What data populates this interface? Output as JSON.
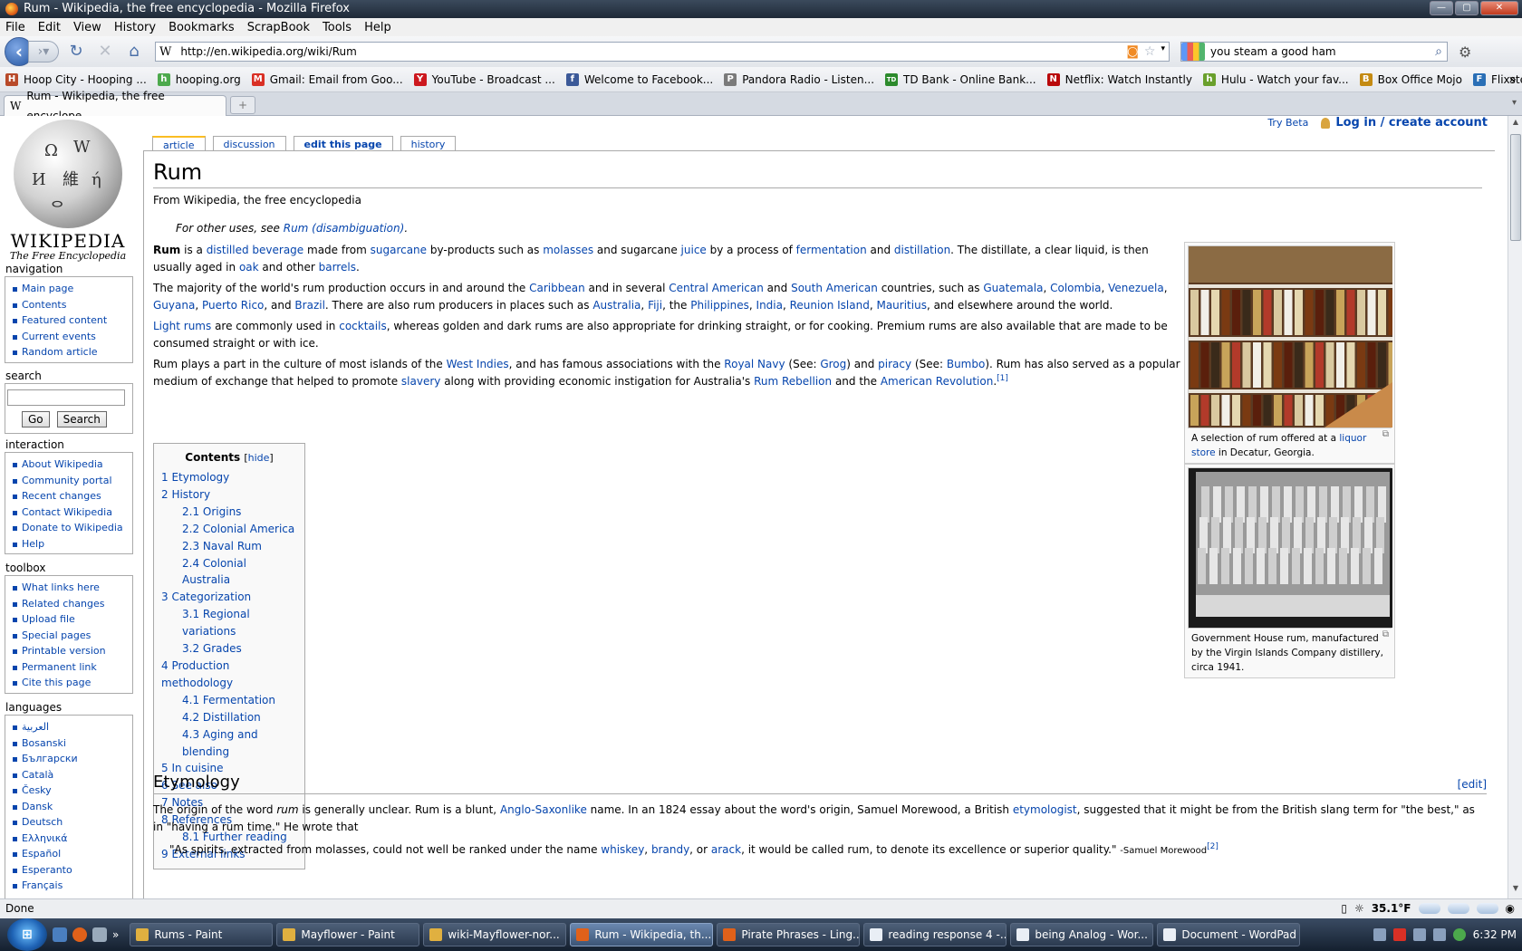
{
  "window": {
    "title": "Rum - Wikipedia, the free encyclopedia - Mozilla Firefox"
  },
  "menu": [
    "File",
    "Edit",
    "View",
    "History",
    "Bookmarks",
    "ScrapBook",
    "Tools",
    "Help"
  ],
  "toolbar": {
    "url": "http://en.wikipedia.org/wiki/Rum",
    "search_value": "you steam a good ham"
  },
  "bookmarks": [
    {
      "label": "Hoop City - Hooping ...",
      "color": "#b84a2a",
      "icon": "H"
    },
    {
      "label": "hooping.org",
      "color": "#4ca94c",
      "icon": "h"
    },
    {
      "label": "Gmail: Email from Goo...",
      "color": "#d93025",
      "icon": "M"
    },
    {
      "label": "YouTube - Broadcast ...",
      "color": "#cc181e",
      "icon": "Y"
    },
    {
      "label": "Welcome to Facebook...",
      "color": "#3b5998",
      "icon": "f"
    },
    {
      "label": "Pandora Radio - Listen...",
      "color": "#7a7a7a",
      "icon": "P"
    },
    {
      "label": "TD Bank - Online Bank...",
      "color": "#2c8a2c",
      "icon": "TD"
    },
    {
      "label": "Netflix: Watch Instantly",
      "color": "#b9090b",
      "icon": "N"
    },
    {
      "label": "Hulu - Watch your fav...",
      "color": "#6aa02c",
      "icon": "h"
    },
    {
      "label": "Box Office Mojo",
      "color": "#c48a12",
      "icon": "B"
    },
    {
      "label": "Flixster - Share Movie ...",
      "color": "#2a6fb6",
      "icon": "F"
    }
  ],
  "tab": {
    "title": "Rum - Wikipedia, the free encyclope...",
    "favicon": "W"
  },
  "personal": {
    "try_beta": "Try Beta",
    "login": "Log in / create account"
  },
  "page_tabs": {
    "article": "article",
    "discussion": "discussion",
    "edit": "edit this page",
    "history": "history"
  },
  "sidebar": {
    "logo_word": "Wikipedia",
    "logo_tagline": "The Free Encyclopedia",
    "navigation_title": "navigation",
    "navigation": [
      "Main page",
      "Contents",
      "Featured content",
      "Current events",
      "Random article"
    ],
    "search_title": "search",
    "go_label": "Go",
    "search_label": "Search",
    "interaction_title": "interaction",
    "interaction": [
      "About Wikipedia",
      "Community portal",
      "Recent changes",
      "Contact Wikipedia",
      "Donate to Wikipedia",
      "Help"
    ],
    "toolbox_title": "toolbox",
    "toolbox": [
      "What links here",
      "Related changes",
      "Upload file",
      "Special pages",
      "Printable version",
      "Permanent link",
      "Cite this page"
    ],
    "languages_title": "languages",
    "languages": [
      "العربية",
      "Bosanski",
      "Български",
      "Català",
      "Česky",
      "Dansk",
      "Deutsch",
      "Ελληνικά",
      "Español",
      "Esperanto",
      "Français"
    ]
  },
  "article": {
    "title": "Rum",
    "subtitle": "From Wikipedia, the free encyclopedia",
    "dab_prefix": "For other uses, see ",
    "dab_link": "Rum (disambiguation)",
    "dab_suffix": ".",
    "p1": [
      {
        "t": "Rum",
        "b": true
      },
      {
        "t": " is a "
      },
      {
        "t": "distilled beverage",
        "l": true
      },
      {
        "t": " made from "
      },
      {
        "t": "sugarcane",
        "l": true
      },
      {
        "t": " by-products such as "
      },
      {
        "t": "molasses",
        "l": true
      },
      {
        "t": " and sugarcane "
      },
      {
        "t": "juice",
        "l": true
      },
      {
        "t": " by a process of "
      },
      {
        "t": "fermentation",
        "l": true
      },
      {
        "t": " and "
      },
      {
        "t": "distillation",
        "l": true
      },
      {
        "t": ". The distillate, a clear liquid, is then usually aged in "
      },
      {
        "t": "oak",
        "l": true
      },
      {
        "t": " and other "
      },
      {
        "t": "barrels",
        "l": true
      },
      {
        "t": "."
      }
    ],
    "p2": [
      {
        "t": "The majority of the world's rum production occurs in and around the "
      },
      {
        "t": "Caribbean",
        "l": true
      },
      {
        "t": " and in several "
      },
      {
        "t": "Central American",
        "l": true
      },
      {
        "t": " and "
      },
      {
        "t": "South American",
        "l": true
      },
      {
        "t": " countries, such as "
      },
      {
        "t": "Guatemala",
        "l": true
      },
      {
        "t": ", "
      },
      {
        "t": "Colombia",
        "l": true
      },
      {
        "t": ", "
      },
      {
        "t": "Venezuela",
        "l": true
      },
      {
        "t": ", "
      },
      {
        "t": "Guyana",
        "l": true
      },
      {
        "t": ", "
      },
      {
        "t": "Puerto Rico",
        "l": true
      },
      {
        "t": ", and "
      },
      {
        "t": "Brazil",
        "l": true
      },
      {
        "t": ". There are also rum producers in places such as "
      },
      {
        "t": "Australia",
        "l": true
      },
      {
        "t": ", "
      },
      {
        "t": "Fiji",
        "l": true
      },
      {
        "t": ", the "
      },
      {
        "t": "Philippines",
        "l": true
      },
      {
        "t": ", "
      },
      {
        "t": "India",
        "l": true
      },
      {
        "t": ", "
      },
      {
        "t": "Reunion Island",
        "l": true
      },
      {
        "t": ", "
      },
      {
        "t": "Mauritius",
        "l": true
      },
      {
        "t": ", and elsewhere around the world."
      }
    ],
    "p3": [
      {
        "t": "Light rums",
        "l": true
      },
      {
        "t": " are commonly used in "
      },
      {
        "t": "cocktails",
        "l": true
      },
      {
        "t": ", whereas golden and dark rums are also appropriate for drinking straight, or for cooking. Premium rums are also available that are made to be consumed straight or with ice."
      }
    ],
    "p4": [
      {
        "t": "Rum plays a part in the culture of most islands of the "
      },
      {
        "t": "West Indies",
        "l": true
      },
      {
        "t": ", and has famous associations with the "
      },
      {
        "t": "Royal Navy",
        "l": true
      },
      {
        "t": " (See: "
      },
      {
        "t": "Grog",
        "l": true
      },
      {
        "t": ") and "
      },
      {
        "t": "piracy",
        "l": true
      },
      {
        "t": " (See: "
      },
      {
        "t": "Bumbo",
        "l": true
      },
      {
        "t": "). Rum has also served as a popular medium of exchange that helped to promote "
      },
      {
        "t": "slavery",
        "l": true
      },
      {
        "t": " along with providing economic instigation for Australia's "
      },
      {
        "t": "Rum Rebellion",
        "l": true
      },
      {
        "t": " and the "
      },
      {
        "t": "American Revolution",
        "l": true
      },
      {
        "t": "."
      },
      {
        "t": "[1]",
        "l": true,
        "sup": true
      }
    ]
  },
  "toc": {
    "title": "Contents",
    "hide": "hide",
    "items": [
      {
        "label": "1 Etymology",
        "level": 1
      },
      {
        "label": "2 History",
        "level": 1
      },
      {
        "label": "2.1 Origins",
        "level": 2
      },
      {
        "label": "2.2 Colonial America",
        "level": 2
      },
      {
        "label": "2.3 Naval Rum",
        "level": 2
      },
      {
        "label": "2.4 Colonial Australia",
        "level": 2
      },
      {
        "label": "3 Categorization",
        "level": 1
      },
      {
        "label": "3.1 Regional variations",
        "level": 2
      },
      {
        "label": "3.2 Grades",
        "level": 2
      },
      {
        "label": "4 Production methodology",
        "level": 1
      },
      {
        "label": "4.1 Fermentation",
        "level": 2
      },
      {
        "label": "4.2 Distillation",
        "level": 2
      },
      {
        "label": "4.3 Aging and blending",
        "level": 2
      },
      {
        "label": "5 In cuisine",
        "level": 1
      },
      {
        "label": "6 See also",
        "level": 1
      },
      {
        "label": "7 Notes",
        "level": 1
      },
      {
        "label": "8 References",
        "level": 1
      },
      {
        "label": "8.1 Further reading",
        "level": 2
      },
      {
        "label": "9 External links",
        "level": 1
      }
    ]
  },
  "images": {
    "cap1_pre": "A selection of rum offered at a ",
    "cap1_link": "liquor store",
    "cap1_post": " in Decatur, Georgia.",
    "cap2": "Government House rum, manufactured by the Virgin Islands Company distillery, circa 1941."
  },
  "etymology": {
    "heading": "Etymology",
    "edit": "[edit]",
    "para": [
      {
        "t": "The origin of the word "
      },
      {
        "t": "rum",
        "i": true
      },
      {
        "t": " is generally unclear. Rum is a blunt, "
      },
      {
        "t": "Anglo-Saxonlike",
        "l": true
      },
      {
        "t": " name. In an 1824 essay about the word's origin, Samuel Morewood, a British "
      },
      {
        "t": "etymologist",
        "l": true
      },
      {
        "t": ", suggested that it might be from the British slang term for \"the best,\" as in \"having a rum time.\" He wrote that"
      }
    ],
    "quote": [
      {
        "t": "\"As spirits, extracted from molasses, could not well be ranked under the name "
      },
      {
        "t": "whiskey",
        "l": true
      },
      {
        "t": ", "
      },
      {
        "t": "brandy",
        "l": true
      },
      {
        "t": ", or "
      },
      {
        "t": "arack",
        "l": true
      },
      {
        "t": ", it would be called rum, to denote its excellence or superior quality.\" "
      },
      {
        "t": "-Samuel Morewood",
        "sm": true
      },
      {
        "t": "[2]",
        "l": true,
        "sup": true
      }
    ]
  },
  "status": {
    "text": "Done",
    "temp": "35.1°F"
  },
  "taskbar": {
    "items": [
      {
        "label": "Rums - Paint",
        "color": "#e0b040"
      },
      {
        "label": "Mayflower - Paint",
        "color": "#e0b040"
      },
      {
        "label": "wiki-Mayflower-nor...",
        "color": "#e0b040"
      },
      {
        "label": "Rum - Wikipedia, th...",
        "color": "#e0611a",
        "active": true
      },
      {
        "label": "Pirate Phrases - Ling...",
        "color": "#e0611a"
      },
      {
        "label": "reading response 4 -...",
        "color": "#e9eef5"
      },
      {
        "label": "being Analog - Wor...",
        "color": "#e9eef5"
      },
      {
        "label": "Document - WordPad",
        "color": "#e9eef5"
      }
    ],
    "clock": "6:32 PM"
  }
}
